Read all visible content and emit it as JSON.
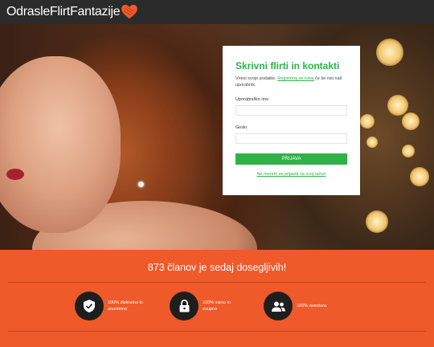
{
  "header": {
    "logo_text": "OdrasleFlirtFantazije",
    "logo_icon": "heart-icon",
    "background_color": "#2b2b2b",
    "heart_color": "#ef5a2a"
  },
  "login": {
    "title": "Skrivni flirti in kontakti",
    "desc_before": "Vnesi svoje podatke.",
    "register_link": "Registriraj se tukaj",
    "desc_after": "če še nisi naš uporabnik.",
    "username_label": "Uporabniško ime",
    "username_value": "",
    "password_label": "Geslo",
    "password_value": "",
    "submit_label": "PRIJAVA",
    "forgot_link": "Ne morem se prijaviti na svoj račun",
    "accent_color": "#2db24a"
  },
  "band": {
    "title": "873 članov je sedaj dosegljivih!",
    "background_color": "#ef5a2a",
    "features": [
      {
        "icon": "shield-check-icon",
        "text": "100% diskretno in anonimno"
      },
      {
        "icon": "lock-icon",
        "text": "100% varno in zaupno"
      },
      {
        "icon": "users-icon",
        "text": "100% avantura"
      }
    ]
  }
}
